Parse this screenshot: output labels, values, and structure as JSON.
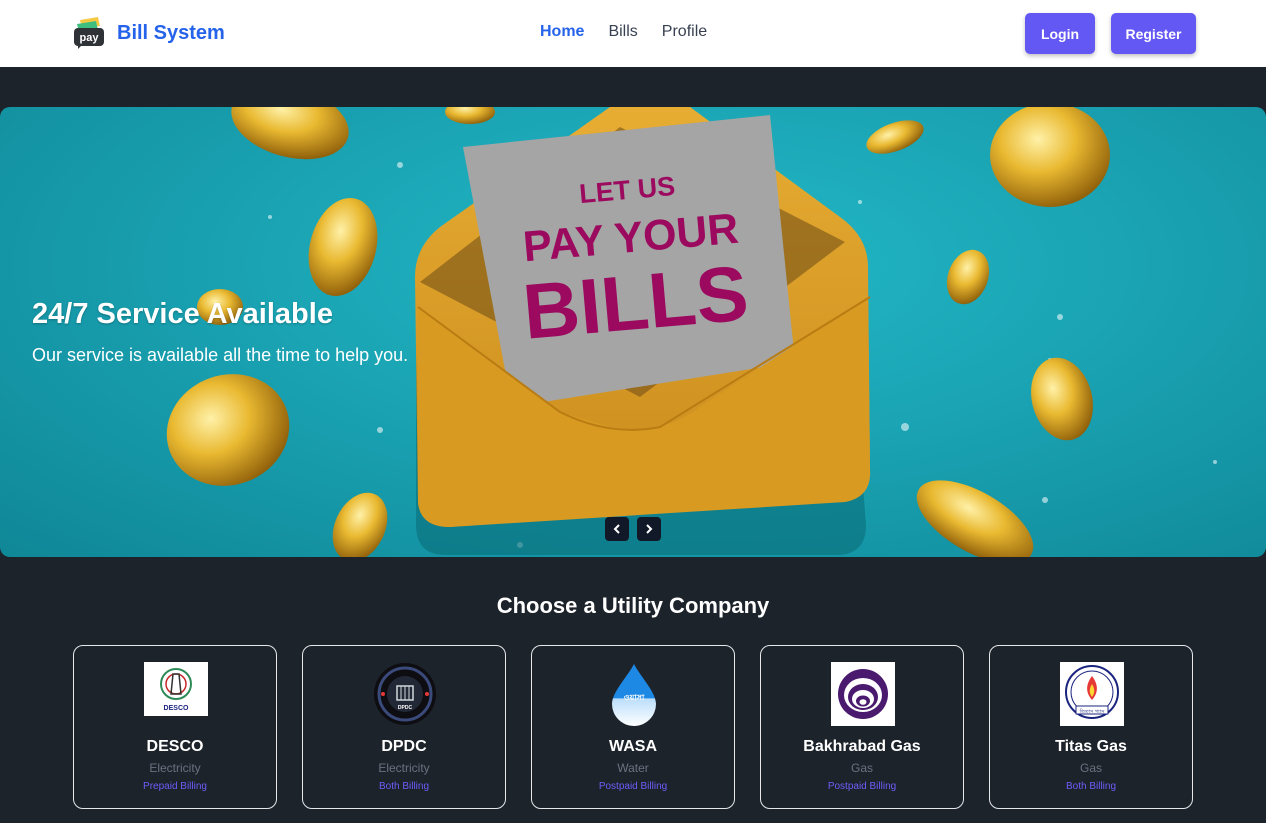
{
  "header": {
    "brand_name": "Bill System",
    "brand_logo_text": "pay",
    "nav": [
      {
        "label": "Home",
        "active": true
      },
      {
        "label": "Bills",
        "active": false
      },
      {
        "label": "Profile",
        "active": false
      }
    ],
    "login_label": "Login",
    "register_label": "Register"
  },
  "hero": {
    "title": "24/7 Service Available",
    "subtitle": "Our service is available all the time to help you.",
    "letter_line1": "LET US",
    "letter_line2": "PAY YOUR",
    "letter_line3": "BILLS",
    "prev_icon": "chevron-left-icon",
    "next_icon": "chevron-right-icon"
  },
  "section": {
    "title": "Choose a Utility Company"
  },
  "companies": [
    {
      "name": "DESCO",
      "type": "Electricity",
      "billing": "Prepaid Billing",
      "logo_text": "DESCO"
    },
    {
      "name": "DPDC",
      "type": "Electricity",
      "billing": "Both Billing",
      "logo_text": "DPDC"
    },
    {
      "name": "WASA",
      "type": "Water",
      "billing": "Postpaid Billing",
      "logo_text": "ওয়াসা"
    },
    {
      "name": "Bakhrabad Gas",
      "type": "Gas",
      "billing": "Postpaid Billing"
    },
    {
      "name": "Titas Gas",
      "type": "Gas",
      "billing": "Both Billing",
      "logo_text": "তিতাস গ্যাস"
    }
  ],
  "colors": {
    "accent": "#6458f5",
    "brand": "#2563eb",
    "background": "#1d232a",
    "hero": "#1aa3b3",
    "letter_text": "#9b0a5e"
  }
}
